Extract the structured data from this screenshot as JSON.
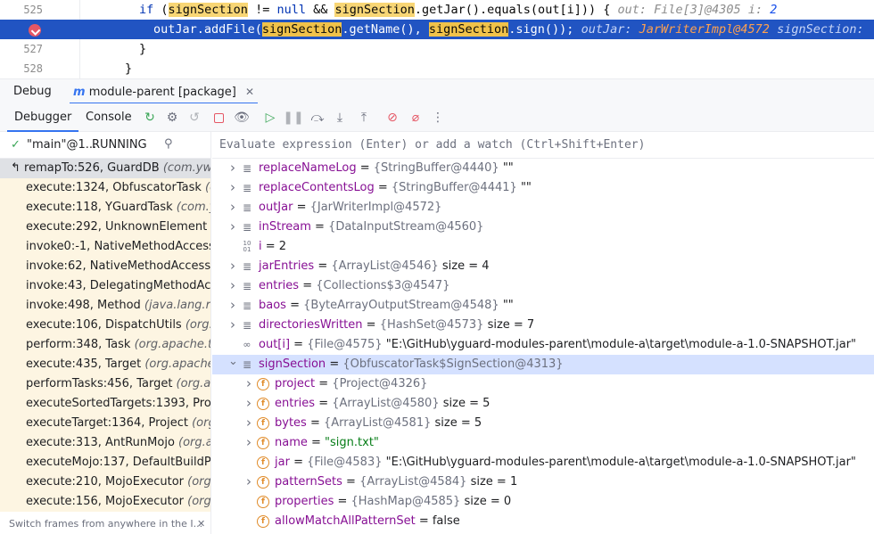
{
  "editor": {
    "lines": [
      {
        "num": "525",
        "indent": "    ",
        "keyword": "if",
        "code": " (signSection != null && signSection.getJar().equals(out[i])) {",
        "hint1_name": "out:",
        "hint1_val": "File[3]@4305",
        "hint2_name": "i:",
        "hint2_val": "2"
      },
      {
        "num": "",
        "code": "outJar.addFile(signSection.getName(), signSection.sign());",
        "hint1_name": "outJar:",
        "hint1_val": "JarWriterImpl@4572",
        "hint2_name": "signSection:"
      },
      {
        "num": "527",
        "code": "}"
      },
      {
        "num": "528",
        "code": "}"
      }
    ]
  },
  "tool_window": {
    "tab_debug": "Debug",
    "tab_session": "module-parent [package]",
    "tab_debugger": "Debugger",
    "tab_console": "Console"
  },
  "frames": {
    "thread": "\"main\"@1...",
    "thread_state": "RUNNING",
    "items": [
      {
        "loc": "remapTo:526, GuardDB",
        "pkg": "(com.ywo"
      },
      {
        "loc": "execute:1324, ObfuscatorTask",
        "pkg": "(c"
      },
      {
        "loc": "execute:118, YGuardTask",
        "pkg": "(com.yw"
      },
      {
        "loc": "execute:292, UnknownElement",
        "pkg": "("
      },
      {
        "loc": "invoke0:-1, NativeMethodAccess",
        "pkg": ""
      },
      {
        "loc": "invoke:62, NativeMethodAccesso",
        "pkg": ""
      },
      {
        "loc": "invoke:43, DelegatingMethodAcce",
        "pkg": ""
      },
      {
        "loc": "invoke:498, Method",
        "pkg": "(java.lang.re"
      },
      {
        "loc": "execute:106, DispatchUtils",
        "pkg": "(org.a"
      },
      {
        "loc": "perform:348, Task",
        "pkg": "(org.apache.to"
      },
      {
        "loc": "execute:435, Target",
        "pkg": "(org.apache."
      },
      {
        "loc": "performTasks:456, Target",
        "pkg": "(org.ap"
      },
      {
        "loc": "executeSortedTargets:1393, Proj",
        "pkg": ""
      },
      {
        "loc": "executeTarget:1364, Project",
        "pkg": "(org.a"
      },
      {
        "loc": "execute:313, AntRunMojo",
        "pkg": "(org.ap"
      },
      {
        "loc": "executeMojo:137, DefaultBuildPlu",
        "pkg": ""
      },
      {
        "loc": "execute:210, MojoExecutor",
        "pkg": "(org.a"
      },
      {
        "loc": "execute:156, MojoExecutor",
        "pkg": "(org.a"
      }
    ],
    "footer": "Switch frames from anywhere in the I..."
  },
  "variables": {
    "eval_placeholder": "Evaluate expression (Enter) or add a watch (Ctrl+Shift+Enter)",
    "rows": [
      {
        "icon": "stack",
        "expand": true,
        "level": 0,
        "name": "replaceNameLog",
        "type": "{StringBuffer@4440}",
        "value": "\"\""
      },
      {
        "icon": "stack",
        "expand": true,
        "level": 0,
        "name": "replaceContentsLog",
        "type": "{StringBuffer@4441}",
        "value": "\"\""
      },
      {
        "icon": "stack",
        "expand": true,
        "level": 0,
        "name": "outJar",
        "type": "{JarWriterImpl@4572}",
        "value": ""
      },
      {
        "icon": "stack",
        "expand": true,
        "level": 0,
        "name": "inStream",
        "type": "{DataInputStream@4560}",
        "value": ""
      },
      {
        "icon": "prim",
        "expand": false,
        "level": 0,
        "name": "i",
        "type": "",
        "value": "2"
      },
      {
        "icon": "stack",
        "expand": true,
        "level": 0,
        "name": "jarEntries",
        "type": "{ArrayList@4546}",
        "value": "size = 4"
      },
      {
        "icon": "stack",
        "expand": true,
        "level": 0,
        "name": "entries",
        "type": "{Collections$3@4547}",
        "value": ""
      },
      {
        "icon": "stack",
        "expand": true,
        "level": 0,
        "name": "baos",
        "type": "{ByteArrayOutputStream@4548}",
        "value": "\"\""
      },
      {
        "icon": "stack",
        "expand": true,
        "level": 0,
        "name": "directoriesWritten",
        "type": "{HashSet@4573}",
        "value": "size = 7"
      },
      {
        "icon": "eye",
        "expand": false,
        "level": 0,
        "name": "out[i]",
        "type": "{File@4575}",
        "value": "\"E:\\GitHub\\yguard-modules-parent\\module-a\\target\\module-a-1.0-SNAPSHOT.jar\""
      },
      {
        "icon": "stack",
        "expand": true,
        "open": true,
        "level": 0,
        "name": "signSection",
        "type": "{ObfuscatorTask$SignSection@4313}",
        "value": "",
        "selected": true
      },
      {
        "icon": "field",
        "expand": true,
        "level": 1,
        "name": "project",
        "type": "{Project@4326}",
        "value": ""
      },
      {
        "icon": "field",
        "expand": true,
        "level": 1,
        "name": "entries",
        "type": "{ArrayList@4580}",
        "value": "size = 5"
      },
      {
        "icon": "field",
        "expand": true,
        "level": 1,
        "name": "bytes",
        "type": "{ArrayList@4581}",
        "value": "size = 5"
      },
      {
        "icon": "field",
        "expand": true,
        "level": 1,
        "name": "name",
        "type": "",
        "value": "\"sign.txt\"",
        "string": true
      },
      {
        "icon": "field",
        "expand": false,
        "level": 1,
        "name": "jar",
        "type": "{File@4583}",
        "value": "\"E:\\GitHub\\yguard-modules-parent\\module-a\\target\\module-a-1.0-SNAPSHOT.jar\""
      },
      {
        "icon": "field",
        "expand": true,
        "level": 1,
        "name": "patternSets",
        "type": "{ArrayList@4584}",
        "value": "size = 1"
      },
      {
        "icon": "field",
        "expand": false,
        "level": 1,
        "name": "properties",
        "type": "{HashMap@4585}",
        "value": "size = 0"
      },
      {
        "icon": "field",
        "expand": false,
        "level": 1,
        "name": "allowMatchAllPatternSet",
        "type": "",
        "value": "false"
      }
    ]
  },
  "colors": {
    "accent": "#3574f0",
    "highlight_line": "#2154c2",
    "frame_bg": "#fdf5e2"
  }
}
